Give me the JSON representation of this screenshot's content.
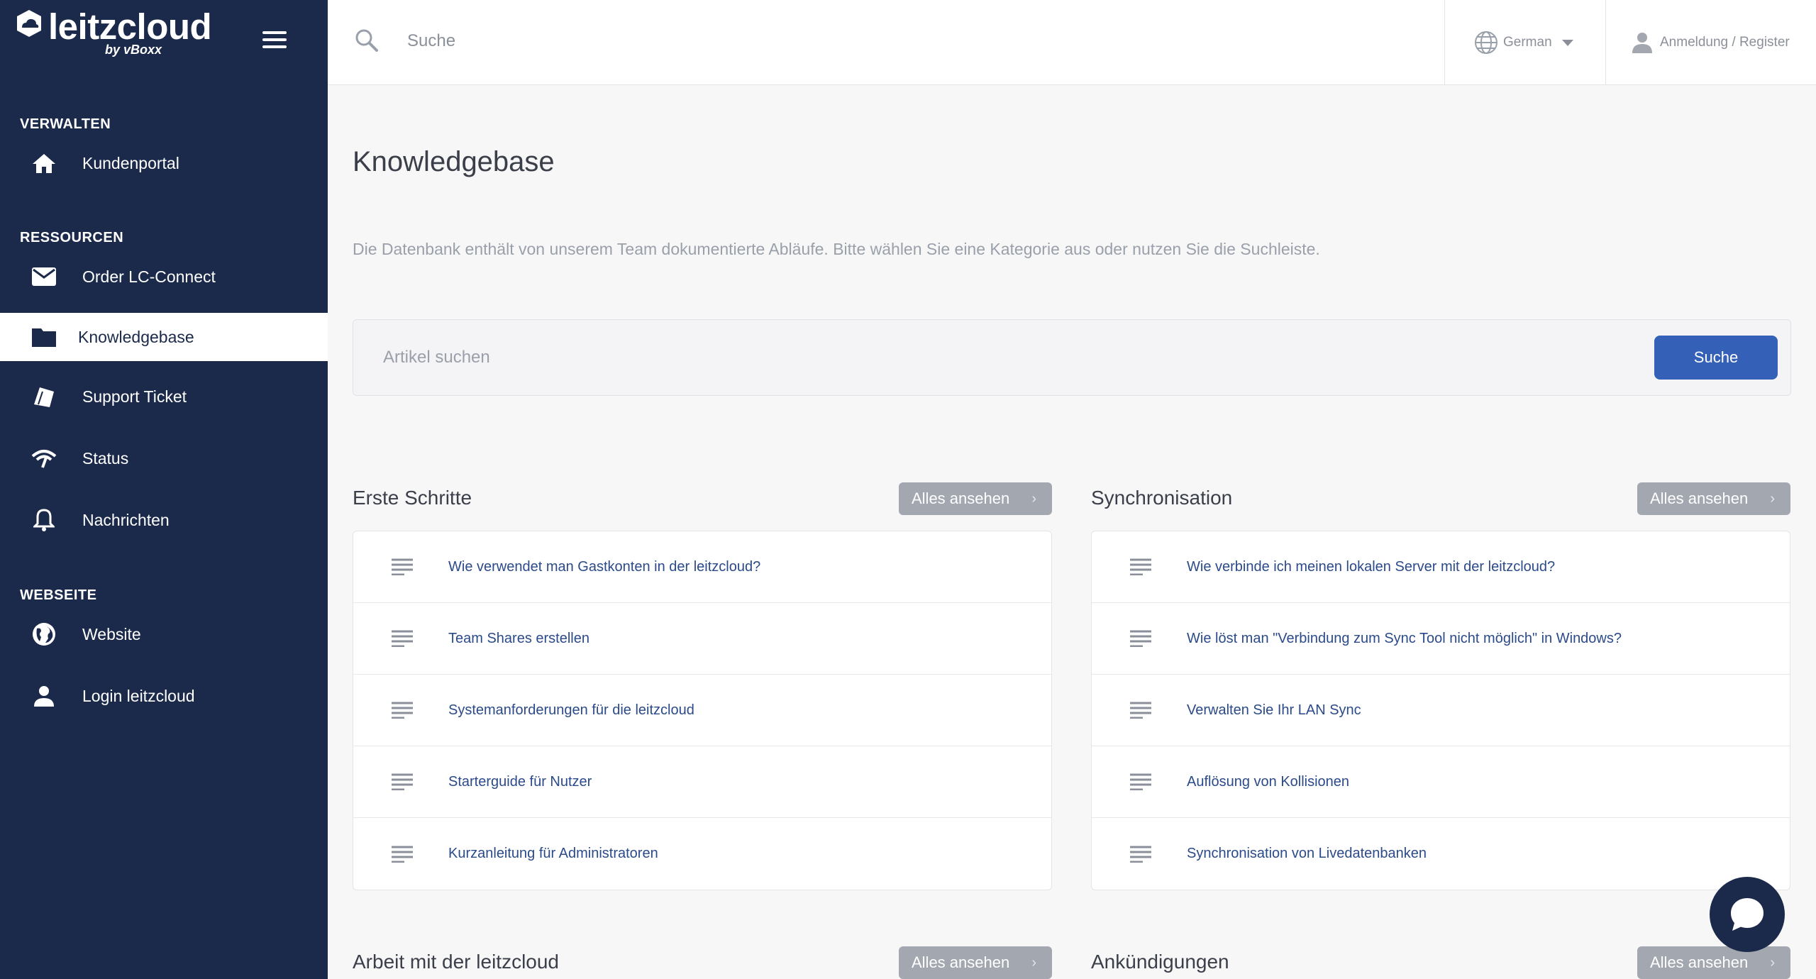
{
  "brand": {
    "name": "leitzcloud",
    "sub": "by vBoxx"
  },
  "sidebar": {
    "sections": [
      {
        "label": "VERWALTEN"
      },
      {
        "label": "RESSOURCEN"
      },
      {
        "label": "WEBSEITE"
      }
    ],
    "items": [
      {
        "label": "Kundenportal",
        "icon": "home-icon"
      },
      {
        "label": "Order LC-Connect",
        "icon": "envelope-icon"
      },
      {
        "label": "Knowledgebase",
        "icon": "folder-icon",
        "active": true
      },
      {
        "label": "Support Ticket",
        "icon": "ticket-icon"
      },
      {
        "label": "Status",
        "icon": "signal-icon"
      },
      {
        "label": "Nachrichten",
        "icon": "bell-icon"
      },
      {
        "label": "Website",
        "icon": "globe-icon"
      },
      {
        "label": "Login leitzcloud",
        "icon": "user-icon"
      }
    ]
  },
  "header": {
    "search_placeholder": "Suche",
    "language": "German",
    "login": "Anmeldung / Register"
  },
  "main": {
    "title": "Knowledgebase",
    "description": "Die Datenbank enthält von unserem Team dokumentierte Abläufe. Bitte wählen Sie eine Kategorie aus oder nutzen Sie die Suchleiste.",
    "search_placeholder": "Artikel suchen",
    "search_button": "Suche",
    "view_all": "Alles ansehen",
    "categories": [
      {
        "title": "Erste Schritte",
        "articles": [
          "Wie verwendet man Gastkonten in der leitzcloud?",
          "Team Shares erstellen",
          "Systemanforderungen für die leitzcloud",
          "Starterguide für Nutzer",
          "Kurzanleitung für Administratoren"
        ]
      },
      {
        "title": "Synchronisation",
        "articles": [
          "Wie verbinde ich meinen lokalen Server mit der leitzcloud?",
          "Wie löst man \"Verbindung zum Sync Tool nicht möglich\" in Windows?",
          "Verwalten Sie Ihr LAN Sync",
          "Auflösung von Kollisionen",
          "Synchronisation von Livedatenbanken"
        ]
      },
      {
        "title": "Arbeit mit der leitzcloud"
      },
      {
        "title": "Ankündigungen"
      }
    ]
  },
  "colors": {
    "sidebar_bg": "#1b2a4a",
    "primary_button": "#3560b7",
    "view_all_button": "#a3a7b0",
    "link": "#2b4a8a"
  }
}
